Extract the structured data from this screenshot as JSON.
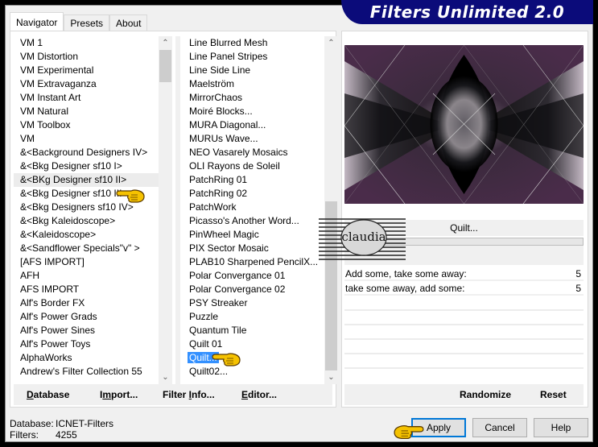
{
  "app": {
    "title": "Filters Unlimited 2.0"
  },
  "tabs": [
    {
      "label": "Navigator",
      "active": true
    },
    {
      "label": "Presets",
      "active": false
    },
    {
      "label": "About",
      "active": false
    }
  ],
  "categories": {
    "items": [
      "VM 1",
      "VM Distortion",
      "VM Experimental",
      "VM Extravaganza",
      "VM Instant Art",
      "VM Natural",
      "VM Toolbox",
      "VM",
      "&<Background Designers IV>",
      "&<Bkg Designer sf10 I>",
      "&<BKg Designer sf10 II>",
      "&<Bkg Designer sf10 III>",
      "&<Bkg Designers sf10 IV>",
      "&<Bkg Kaleidoscope>",
      "&<Kaleidoscope>",
      "&<Sandflower Specials\"v\" >",
      "[AFS IMPORT]",
      "AFH",
      "AFS IMPORT",
      "Alf's Border FX",
      "Alf's Power Grads",
      "Alf's Power Sines",
      "Alf's Power Toys",
      "AlphaWorks",
      "Andrew's Filter Collection 55"
    ],
    "highlighted": "&<BKg Designer sf10 II>"
  },
  "filters": {
    "items": [
      "Line Blurred Mesh",
      "Line Panel Stripes",
      "Line Side Line",
      "Maelström",
      "MirrorChaos",
      "Moiré Blocks...",
      "MURA Diagonal...",
      "MURUs Wave...",
      "NEO Vasarely Mosaics",
      "OLI Rayons de Soleil",
      "PatchRing 01",
      "PatchRing 02",
      "PatchWork",
      "Picasso's Another Word...",
      "PinWheel Magic",
      "PIX Sector Mosaic",
      "PLAB10 Sharpened PencilX...",
      "Polar Convergance 01",
      "Polar Convergance 02",
      "PSY Streaker",
      "Puzzle",
      "Quantum Tile",
      "Quilt 01",
      "Quilt...",
      "Quilt02..."
    ],
    "selected": "Quilt..."
  },
  "left_buttons": {
    "database": "Database",
    "import": "Import...",
    "filter_info": "Filter Info...",
    "editor": "Editor..."
  },
  "filter_panel": {
    "title": "Quilt...",
    "progress": 0,
    "params": [
      {
        "label": "Add some, take some away:",
        "value": "5"
      },
      {
        "label": "take some away, add some:",
        "value": "5"
      }
    ],
    "randomize": "Randomize",
    "reset": "Reset"
  },
  "status": {
    "database_label": "Database:",
    "database_value": "ICNET-Filters",
    "filters_label": "Filters:",
    "filters_value": "4255"
  },
  "dialog_buttons": {
    "apply": "Apply",
    "cancel": "Cancel",
    "help": "Help"
  },
  "watermark": {
    "text": "claudia"
  },
  "colors": {
    "banner": "#0b0b7a",
    "selection": "#3390ff",
    "default_button_border": "#0078d7",
    "preview_purple": "#4a2a4a"
  }
}
